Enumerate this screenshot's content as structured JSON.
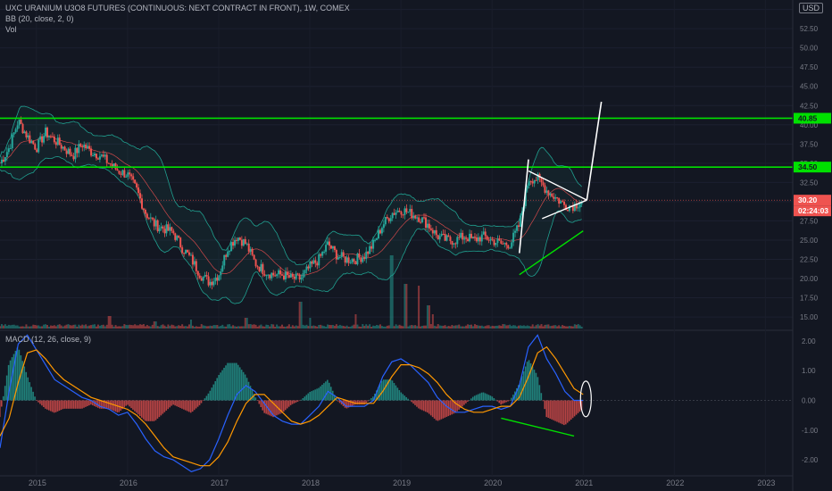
{
  "header": {
    "title": "UXC URANIUM U3O8 FUTURES (CONTINUOUS: NEXT CONTRACT IN FRONT), 1W, COMEX",
    "bb_label": "BB (20, close, 2, 0)",
    "vol_label": "Vol",
    "currency": "USD"
  },
  "macd_panel": {
    "label": "MACD (12, 26, close, 9)"
  },
  "price_badges": {
    "upper_level": "40.85",
    "lower_level": "34.50",
    "last_price": "30.20",
    "countdown": "02:24:03"
  },
  "colors": {
    "background": "#131722",
    "up": "#26a69a",
    "down": "#ef5350",
    "level_line": "#00e000",
    "bb_basis": "#ff5252",
    "bb_band": "#20a090",
    "macd_line": "#2962ff",
    "signal_line": "#ff9800",
    "drawing": "#ffffff"
  },
  "chart_data": [
    {
      "type": "candlestick",
      "title": "UXC URANIUM U3O8 FUTURES (CONTINUOUS: NEXT CONTRACT IN FRONT), 1W, COMEX",
      "x_ticks": [
        "2015",
        "2016",
        "2017",
        "2018",
        "2019",
        "2020",
        "2021",
        "2022",
        "2023"
      ],
      "x_range": [
        2014.6,
        2023.3
      ],
      "y_ticks": [
        "15.00",
        "17.50",
        "20.00",
        "22.50",
        "25.00",
        "27.50",
        "30.00",
        "32.50",
        "35.00",
        "37.50",
        "40.00",
        "42.50",
        "45.00",
        "47.50",
        "50.00",
        "52.50",
        "55.00"
      ],
      "y_range": [
        13.5,
        56.0
      ],
      "horizontal_levels": [
        40.85,
        34.5
      ],
      "last_price": 30.2,
      "close_series": {
        "x": [
          2014.6,
          2014.7,
          2014.8,
          2014.9,
          2015.0,
          2015.1,
          2015.2,
          2015.3,
          2015.4,
          2015.5,
          2015.6,
          2015.7,
          2015.8,
          2015.9,
          2016.0,
          2016.1,
          2016.2,
          2016.3,
          2016.4,
          2016.5,
          2016.6,
          2016.7,
          2016.8,
          2016.9,
          2017.0,
          2017.1,
          2017.2,
          2017.3,
          2017.4,
          2017.5,
          2017.6,
          2017.7,
          2017.8,
          2017.9,
          2018.0,
          2018.1,
          2018.2,
          2018.3,
          2018.4,
          2018.5,
          2018.6,
          2018.7,
          2018.8,
          2018.9,
          2019.0,
          2019.1,
          2019.2,
          2019.3,
          2019.4,
          2019.5,
          2019.6,
          2019.7,
          2019.8,
          2019.9,
          2020.0,
          2020.1,
          2020.2,
          2020.3,
          2020.4,
          2020.5,
          2020.6,
          2020.7,
          2020.8,
          2020.9,
          2021.0
        ],
        "close": [
          35.0,
          37.0,
          40.5,
          38.5,
          37.0,
          39.0,
          38.0,
          37.0,
          36.0,
          37.5,
          36.5,
          36.0,
          35.0,
          34.0,
          33.5,
          31.5,
          28.5,
          27.0,
          26.5,
          26.0,
          24.0,
          22.5,
          20.5,
          19.5,
          20.5,
          24.0,
          25.5,
          24.5,
          22.0,
          21.0,
          20.5,
          20.5,
          20.0,
          20.0,
          21.5,
          22.5,
          24.5,
          23.0,
          22.5,
          22.5,
          23.0,
          24.5,
          27.0,
          28.5,
          29.0,
          28.5,
          28.0,
          27.0,
          25.5,
          25.0,
          25.0,
          25.5,
          25.0,
          25.5,
          25.0,
          24.5,
          24.5,
          27.0,
          33.0,
          33.0,
          31.5,
          30.5,
          29.5,
          29.5,
          30.2
        ]
      }
    },
    {
      "type": "line",
      "title": "MACD (12, 26, close, 9)",
      "y_ticks": [
        "2.00",
        "1.00",
        "0.00",
        "-1.00",
        "-2.00"
      ],
      "y_range": [
        -2.45,
        2.3
      ],
      "x": [
        2014.6,
        2014.7,
        2014.8,
        2014.9,
        2015.0,
        2015.1,
        2015.2,
        2015.3,
        2015.4,
        2015.5,
        2015.6,
        2015.7,
        2015.8,
        2015.9,
        2016.0,
        2016.1,
        2016.2,
        2016.3,
        2016.4,
        2016.5,
        2016.6,
        2016.7,
        2016.8,
        2016.9,
        2017.0,
        2017.1,
        2017.2,
        2017.3,
        2017.4,
        2017.5,
        2017.6,
        2017.7,
        2017.8,
        2017.9,
        2018.0,
        2018.1,
        2018.2,
        2018.3,
        2018.4,
        2018.5,
        2018.6,
        2018.7,
        2018.8,
        2018.9,
        2019.0,
        2019.1,
        2019.2,
        2019.3,
        2019.4,
        2019.5,
        2019.6,
        2019.7,
        2019.8,
        2019.9,
        2020.0,
        2020.1,
        2020.2,
        2020.3,
        2020.4,
        2020.5,
        2020.6,
        2020.7,
        2020.8,
        2020.9,
        2021.0
      ],
      "series": [
        {
          "values": [
            -1.6,
            0.3,
            1.9,
            2.2,
            1.7,
            1.2,
            0.7,
            0.5,
            0.3,
            0.1,
            0.0,
            -0.2,
            -0.3,
            -0.5,
            -0.4,
            -0.8,
            -1.3,
            -1.7,
            -1.9,
            -2.0,
            -2.2,
            -2.4,
            -2.3,
            -2.0,
            -1.3,
            -0.5,
            0.2,
            0.5,
            0.3,
            -0.1,
            -0.5,
            -0.7,
            -0.8,
            -0.8,
            -0.5,
            -0.2,
            0.3,
            0.1,
            -0.2,
            -0.2,
            -0.2,
            0.0,
            0.8,
            1.3,
            1.4,
            1.2,
            0.9,
            0.6,
            0.1,
            -0.2,
            -0.4,
            -0.4,
            -0.3,
            -0.2,
            -0.2,
            -0.3,
            -0.2,
            0.5,
            1.8,
            2.2,
            1.4,
            0.9,
            0.3,
            0.0,
            0.0
          ]
        },
        {
          "values": [
            -1.2,
            -0.6,
            0.6,
            1.6,
            1.7,
            1.4,
            1.0,
            0.7,
            0.5,
            0.3,
            0.1,
            0.0,
            -0.1,
            -0.2,
            -0.3,
            -0.5,
            -0.8,
            -1.2,
            -1.6,
            -1.9,
            -2.0,
            -2.1,
            -2.2,
            -2.2,
            -1.9,
            -1.4,
            -0.7,
            -0.1,
            0.2,
            0.2,
            -0.1,
            -0.4,
            -0.7,
            -0.8,
            -0.7,
            -0.5,
            -0.2,
            0.1,
            0.0,
            -0.1,
            -0.1,
            -0.1,
            0.3,
            0.8,
            1.2,
            1.2,
            1.1,
            0.9,
            0.6,
            0.2,
            -0.1,
            -0.3,
            -0.4,
            -0.4,
            -0.3,
            -0.2,
            -0.2,
            0.1,
            0.8,
            1.6,
            1.8,
            1.4,
            0.9,
            0.4,
            0.2
          ]
        }
      ]
    }
  ]
}
